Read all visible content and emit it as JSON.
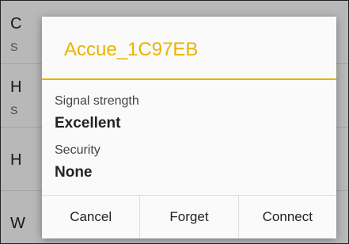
{
  "background_list": [
    {
      "title": "C",
      "subtitle": "S"
    },
    {
      "title": "H",
      "subtitle": "S"
    },
    {
      "title": "H",
      "subtitle": ""
    },
    {
      "title": "W",
      "subtitle": ""
    }
  ],
  "dialog": {
    "title": "Accue_1C97EB",
    "fields": [
      {
        "label": "Signal strength",
        "value": "Excellent"
      },
      {
        "label": "Security",
        "value": "None"
      }
    ],
    "buttons": {
      "cancel": "Cancel",
      "forget": "Forget",
      "connect": "Connect"
    }
  },
  "colors": {
    "accent": "#e8b400"
  }
}
